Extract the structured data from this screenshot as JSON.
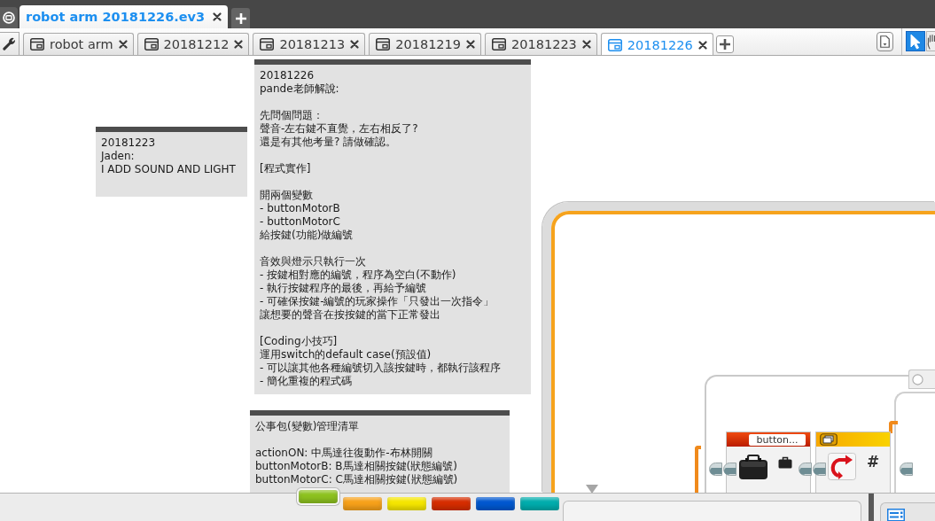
{
  "title_bar": {
    "project_tabs": [
      {
        "label": "robot arm 20181226.ev3",
        "selected": true
      }
    ]
  },
  "program_tabs": [
    {
      "label": "robot arm",
      "selected": false
    },
    {
      "label": "20181212",
      "selected": false
    },
    {
      "label": "20181213",
      "selected": false
    },
    {
      "label": "20181219",
      "selected": false
    },
    {
      "label": "20181223",
      "selected": false
    },
    {
      "label": "20181226",
      "selected": true
    }
  ],
  "toolbar": {
    "tools": [
      {
        "kind": "select",
        "selected": true
      },
      {
        "kind": "pan",
        "selected": false
      }
    ]
  },
  "canvas": {
    "comments": [
      {
        "paragraphs": [
          [
            "20181223",
            "Jaden:",
            "I ADD SOUND AND LIGHT"
          ]
        ]
      },
      {
        "paragraphs": [
          [
            "20181226",
            "pande老師解說:"
          ],
          [
            "先問個問題：",
            "聲音-左右鍵不直覺，左右相反了?",
            "還是有其他考量? 請做確認。"
          ],
          [
            "[程式實作]"
          ],
          [
            "開兩個變數",
            "- buttonMotorB",
            "- buttonMotorC",
            "給按鍵(功能)做編號"
          ],
          [
            "音效與燈示只執行一次",
            "- 按鍵相對應的編號，程序為空白(不動作)",
            "- 執行按鍵程序的最後，再給予編號",
            "- 可確保按鍵-編號的玩家操作「只發出一次指令」",
            "讓想要的聲音在按按鍵的當下正常發出"
          ],
          [
            "[Coding小技巧]",
            "運用switch的default case(預設值)",
            "- 可以讓其他各種編號切入該按鍵時，都執行該程序",
            "- 簡化重複的程式碼"
          ]
        ]
      },
      {
        "paragraphs": [
          [
            "公事包(變數)管理清單"
          ],
          [
            "actionON: 中馬達往復動作-布林開關",
            "buttonMotorB: B馬達相關按鍵(狀態編號)",
            "buttonMotorC: C馬達相關按鍵(狀態編號)"
          ]
        ]
      }
    ],
    "blocks": [
      {
        "kind": "variable",
        "label": "button..."
      },
      {
        "kind": "math",
        "label": "#"
      }
    ]
  },
  "palette": {
    "tabs": [
      {
        "color": "#8dc21f",
        "selected": true
      },
      {
        "color": "#f7a11a",
        "selected": false
      },
      {
        "color": "#f5e600",
        "selected": false
      },
      {
        "color": "#d62d00",
        "selected": false
      },
      {
        "color": "#0058d0",
        "selected": false
      },
      {
        "color": "#00adad",
        "selected": false
      }
    ]
  }
}
